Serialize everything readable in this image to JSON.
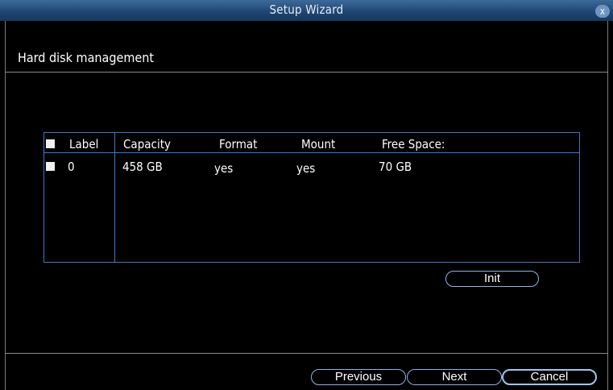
{
  "window": {
    "title": "Setup Wizard",
    "close_label": "x"
  },
  "page": {
    "heading": "Hard disk management"
  },
  "table": {
    "headers": [
      "Label",
      "Capacity",
      "Format",
      "Mount",
      "Free Space:"
    ],
    "rows": [
      [
        "0",
        "458 GB",
        "yes",
        "yes",
        "70 GB"
      ]
    ]
  },
  "buttons": {
    "init": "Init",
    "previous": "Previous",
    "next": "Next",
    "cancel": "Cancel"
  },
  "colors": {
    "titlebar": "#1e4470",
    "accent_border": "#3a79c4",
    "background": "#000000"
  }
}
